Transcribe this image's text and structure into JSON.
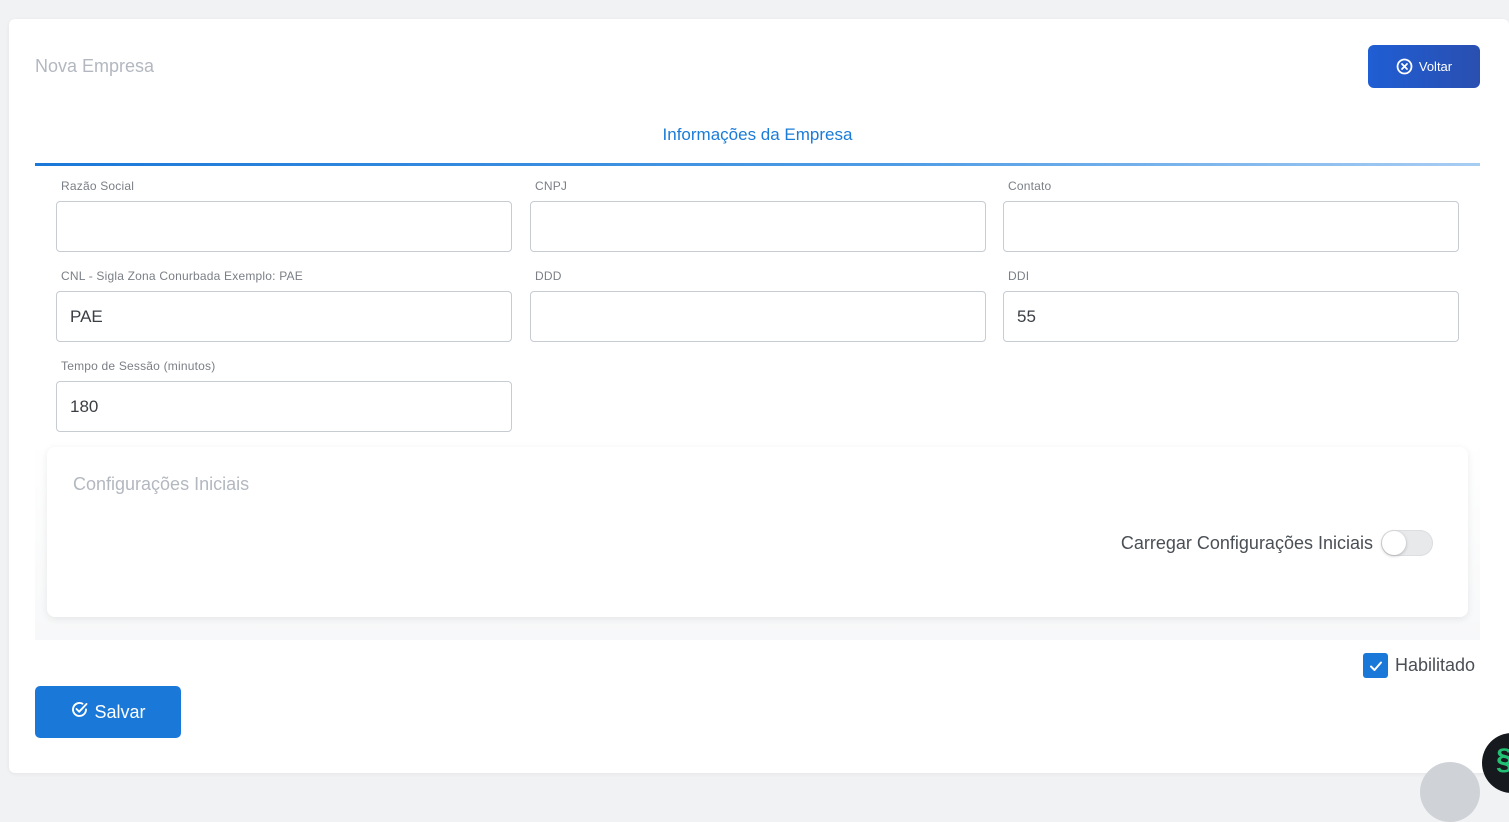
{
  "header": {
    "title": "Nova Empresa",
    "back_button_label": "Voltar"
  },
  "tab": {
    "label": "Informações da Empresa"
  },
  "fields": {
    "razao_social": {
      "label": "Razão Social",
      "value": ""
    },
    "cnpj": {
      "label": "CNPJ",
      "value": ""
    },
    "contato": {
      "label": "Contato",
      "value": ""
    },
    "cnl": {
      "label": "CNL - Sigla Zona Conurbada Exemplo: PAE",
      "value": "PAE"
    },
    "ddd": {
      "label": "DDD",
      "value": ""
    },
    "ddi": {
      "label": "DDI",
      "value": "55"
    },
    "tempo_sessao": {
      "label": "Tempo de Sessão (minutos)",
      "value": "180"
    }
  },
  "config_panel": {
    "title": "Configurações Iniciais",
    "toggle_label": "Carregar Configurações Iniciais",
    "toggle_on": false
  },
  "enabled": {
    "label": "Habilitado",
    "checked": true
  },
  "actions": {
    "save_label": "Salvar"
  },
  "colors": {
    "primary": "#1a78d8",
    "back_button": "#1f5ed4",
    "muted_title": "#b3b8c0"
  }
}
